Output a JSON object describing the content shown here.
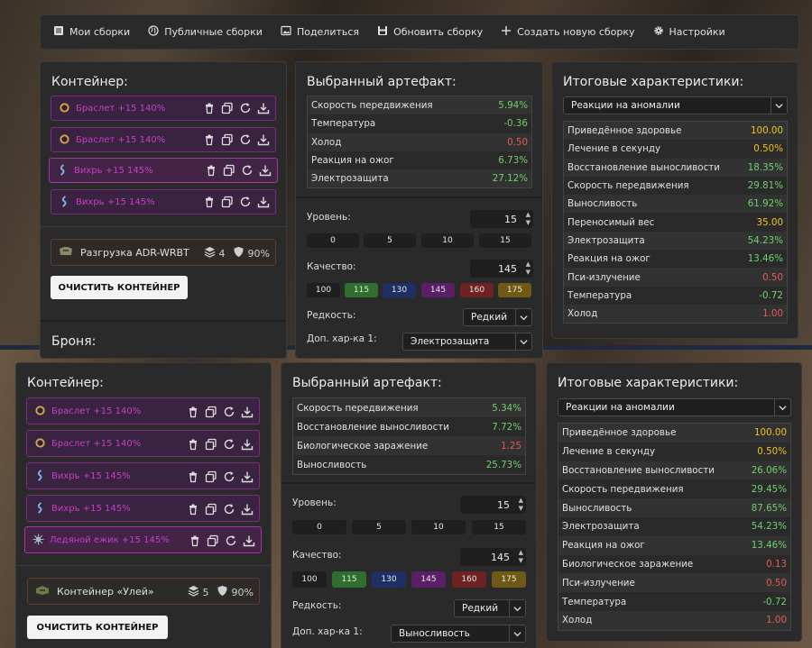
{
  "toolbar": {
    "items": [
      "Мои сборки",
      "Публичные сборки",
      "Поделиться",
      "Обновить сборку",
      "Создать новую сборку",
      "Настройки"
    ]
  },
  "top": {
    "container": {
      "title": "Контейнер:",
      "artifacts": [
        {
          "name": "Браслет +15 140%",
          "icon": "bracelet-icon"
        },
        {
          "name": "Браслет +15 140%",
          "icon": "bracelet-icon"
        },
        {
          "name": "Вихрь +15 145%",
          "icon": "whirl-icon"
        },
        {
          "name": "Вихрь +15 145%",
          "icon": "whirl-icon"
        }
      ],
      "container_item": {
        "name": "Разгрузка ADR-WRBT",
        "slots": "4",
        "protection": "90%"
      },
      "clear_label": "ОЧИСТИТЬ КОНТЕЙНЕР",
      "next_title": "Броня:"
    },
    "selected": {
      "title": "Выбранный артефакт:",
      "stats": [
        {
          "label": "Скорость передвижения",
          "value": "5.94%",
          "tone": "pos"
        },
        {
          "label": "Температура",
          "value": "-0.36",
          "tone": "pos"
        },
        {
          "label": "Холод",
          "value": "0.50",
          "tone": "neg"
        },
        {
          "label": "Реакция на ожог",
          "value": "6.73%",
          "tone": "pos"
        },
        {
          "label": "Электрозащита",
          "value": "27.12%",
          "tone": "pos"
        }
      ],
      "level_label": "Уровень:",
      "level_value": "15",
      "level_presets": [
        "0",
        "5",
        "10",
        "15"
      ],
      "quality_label": "Качество:",
      "quality_value": "145",
      "quality_presets": [
        {
          "label": "100",
          "color": "#1f1f1f"
        },
        {
          "label": "115",
          "color": "#2f6e2f"
        },
        {
          "label": "130",
          "color": "#1f2f66"
        },
        {
          "label": "145",
          "color": "#5a1f66"
        },
        {
          "label": "160",
          "color": "#6e2222"
        },
        {
          "label": "175",
          "color": "#6e5a16"
        }
      ],
      "rarity_label": "Редкость:",
      "rarity_value": "Редкий",
      "extra_label": "Доп. хар-ка 1:",
      "extra_value": "Электрозащита"
    },
    "totals": {
      "title": "Итоговые характеристики:",
      "filter": "Реакции на аномалии",
      "stats": [
        {
          "label": "Приведённое здоровье",
          "value": "100.00",
          "tone": "neu"
        },
        {
          "label": "Лечение в секунду",
          "value": "0.50%",
          "tone": "neu"
        },
        {
          "label": "Восстановление выносливости",
          "value": "18.35%",
          "tone": "pos"
        },
        {
          "label": "Скорость передвижения",
          "value": "29.81%",
          "tone": "pos"
        },
        {
          "label": "Выносливость",
          "value": "61.92%",
          "tone": "pos"
        },
        {
          "label": "Переносимый вес",
          "value": "35.00",
          "tone": "neu"
        },
        {
          "label": "Электрозащита",
          "value": "54.23%",
          "tone": "pos"
        },
        {
          "label": "Реакция на ожог",
          "value": "13.46%",
          "tone": "pos"
        },
        {
          "label": "Пси-излучение",
          "value": "0.50",
          "tone": "neg"
        },
        {
          "label": "Температура",
          "value": "-0.72",
          "tone": "pos"
        },
        {
          "label": "Холод",
          "value": "1.00",
          "tone": "neg"
        }
      ]
    }
  },
  "bottom": {
    "container": {
      "title": "Контейнер:",
      "artifacts": [
        {
          "name": "Браслет +15 140%",
          "icon": "bracelet-icon"
        },
        {
          "name": "Браслет +15 140%",
          "icon": "bracelet-icon"
        },
        {
          "name": "Вихрь +15 145%",
          "icon": "whirl-icon"
        },
        {
          "name": "Вихрь +15 145%",
          "icon": "whirl-icon"
        },
        {
          "name": "Ледяной ежик +15 145%",
          "icon": "ice-hedgehog-icon"
        }
      ],
      "container_item": {
        "name": "Контейнер «Улей»",
        "slots": "5",
        "protection": "90%"
      },
      "clear_label": "ОЧИСТИТЬ КОНТЕЙНЕР"
    },
    "selected": {
      "title": "Выбранный артефакт:",
      "stats": [
        {
          "label": "Скорость передвижения",
          "value": "5.34%",
          "tone": "pos"
        },
        {
          "label": "Восстановление выносливости",
          "value": "7.72%",
          "tone": "pos"
        },
        {
          "label": "Биологическое заражение",
          "value": "1.25",
          "tone": "neg"
        },
        {
          "label": "Выносливость",
          "value": "25.73%",
          "tone": "pos"
        }
      ],
      "level_label": "Уровень:",
      "level_value": "15",
      "level_presets": [
        "0",
        "5",
        "10",
        "15"
      ],
      "quality_label": "Качество:",
      "quality_value": "145",
      "quality_presets": [
        {
          "label": "100",
          "color": "#1f1f1f"
        },
        {
          "label": "115",
          "color": "#2f6e2f"
        },
        {
          "label": "130",
          "color": "#1f2f66"
        },
        {
          "label": "145",
          "color": "#5a1f66"
        },
        {
          "label": "160",
          "color": "#6e2222"
        },
        {
          "label": "175",
          "color": "#6e5a16"
        }
      ],
      "rarity_label": "Редкость:",
      "rarity_value": "Редкий",
      "extra_label": "Доп. хар-ка 1:",
      "extra_value": "Выносливость"
    },
    "totals": {
      "title": "Итоговые характеристики:",
      "filter": "Реакции на аномалии",
      "stats": [
        {
          "label": "Приведённое здоровье",
          "value": "100.00",
          "tone": "neu"
        },
        {
          "label": "Лечение в секунду",
          "value": "0.50%",
          "tone": "neu"
        },
        {
          "label": "Восстановление выносливости",
          "value": "26.06%",
          "tone": "pos"
        },
        {
          "label": "Скорость передвижения",
          "value": "29.45%",
          "tone": "pos"
        },
        {
          "label": "Выносливость",
          "value": "87.65%",
          "tone": "pos"
        },
        {
          "label": "Электрозащита",
          "value": "54.23%",
          "tone": "pos"
        },
        {
          "label": "Реакция на ожог",
          "value": "13.46%",
          "tone": "pos"
        },
        {
          "label": "Биологическое заражение",
          "value": "0.13",
          "tone": "neg"
        },
        {
          "label": "Пси-излучение",
          "value": "0.50",
          "tone": "neg"
        },
        {
          "label": "Температура",
          "value": "-0.72",
          "tone": "pos"
        },
        {
          "label": "Холод",
          "value": "1.00",
          "tone": "neg"
        }
      ]
    }
  }
}
